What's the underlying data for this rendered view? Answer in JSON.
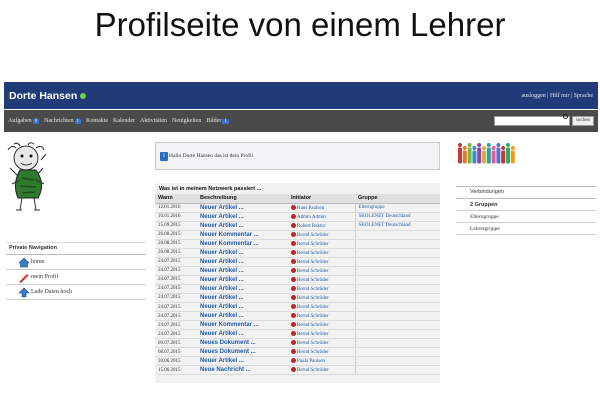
{
  "slide_title": "Profilseite von einem Lehrer",
  "header": {
    "user_name": "Dorte Hansen",
    "links": "ausloggen | Hilf mir | Sprache"
  },
  "menu": [
    {
      "label": "Aufgaben",
      "badge": "0"
    },
    {
      "label": "Nachrichten",
      "badge": "1"
    },
    {
      "label": "Kontakte",
      "badge": ""
    },
    {
      "label": "Kalender",
      "badge": ""
    },
    {
      "label": "Aktivitäten",
      "badge": ""
    },
    {
      "label": "Neuigkeiten",
      "badge": ""
    },
    {
      "label": "Bilder",
      "badge": "1"
    }
  ],
  "search": {
    "button_label": "suchen",
    "placeholder": ""
  },
  "private_nav": {
    "title": "Private Navigation",
    "items": [
      "home",
      "mein Profil",
      "Lade Daten hoch"
    ]
  },
  "hello": "Hallo Dorte Hansen das ist dein Profil",
  "network": {
    "title": "Was ist in meinem Netzwerk passiert ...",
    "columns": [
      "Wann",
      "Beschreibung",
      "Initiator",
      "Gruppe"
    ],
    "rows": [
      [
        "12.01.2016",
        "Neuer Artikel ...",
        "Hans Paulsen",
        "Elterngruppe"
      ],
      [
        "10.01.2016",
        "Neuer Artikel ...",
        "Admin Admin",
        "SKOLENET Deutschland"
      ],
      [
        "15.09.2015",
        "Neuer Artikel ...",
        "Robert Rektor",
        "SKOLENET Deutschland"
      ],
      [
        "26.08.2015",
        "Neuer Kommentar ...",
        "Bernd Schröder",
        ""
      ],
      [
        "26.08.2015",
        "Neuer Kommentar ...",
        "Bernd Schröder",
        ""
      ],
      [
        "26.08.2015",
        "Neuer Artikel ...",
        "Bernd Schröder",
        ""
      ],
      [
        "24.07.2015",
        "Neuer Artikel ...",
        "Bernd Schröder",
        ""
      ],
      [
        "24.07.2015",
        "Neuer Artikel ...",
        "Bernd Schröder",
        ""
      ],
      [
        "24.07.2015",
        "Neuer Artikel ...",
        "Bernd Schröder",
        ""
      ],
      [
        "24.07.2015",
        "Neuer Artikel ...",
        "Bernd Schröder",
        ""
      ],
      [
        "24.07.2015",
        "Neuer Artikel ...",
        "Bernd Schröder",
        ""
      ],
      [
        "24.07.2015",
        "Neuer Artikel ...",
        "Bernd Schröder",
        ""
      ],
      [
        "24.07.2015",
        "Neuer Artikel ...",
        "Bernd Schröder",
        ""
      ],
      [
        "24.07.2015",
        "Neuer Kommentar ...",
        "Bernd Schröder",
        ""
      ],
      [
        "24.07.2015",
        "Neuer Artikel ...",
        "Bernd Schröder",
        ""
      ],
      [
        "09.07.2015",
        "Neues Dokument ...",
        "Bernd Schröder",
        ""
      ],
      [
        "08.07.2015",
        "Neues Dokument ...",
        "Bernd Schröder",
        ""
      ],
      [
        "20.06.2015",
        "Neuer Artikel ...",
        "Paula Paulsen",
        ""
      ],
      [
        "15.06.2015",
        "Neue Nachricht ...",
        "Bernd Schröder",
        ""
      ]
    ]
  },
  "connections": {
    "title": "Verbindungen",
    "items": [
      "2 Gruppen",
      "Elterngruppe",
      "Lehrergruppe"
    ]
  },
  "colors": {
    "header_bg": "#213a78",
    "menu_bg": "#4a4a4a",
    "link_blue": "#1f5aa6",
    "badge_blue": "#3b6fc9"
  }
}
